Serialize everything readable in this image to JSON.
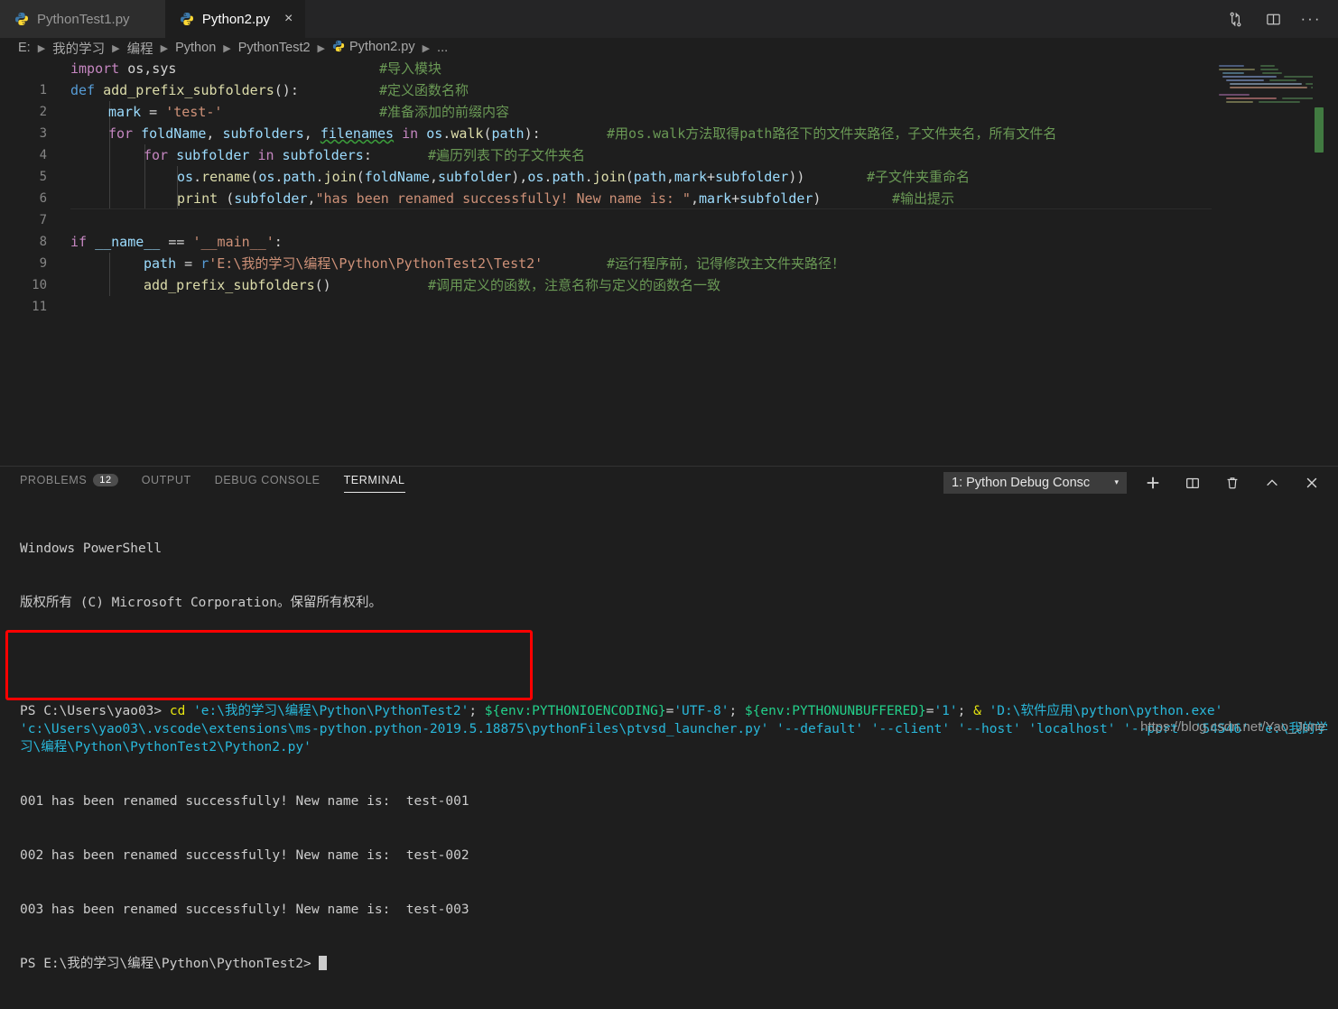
{
  "tabs": [
    {
      "label": "PythonTest1.py",
      "icon": "python-icon",
      "active": false
    },
    {
      "label": "Python2.py",
      "icon": "python-icon",
      "active": true,
      "close": "×"
    }
  ],
  "tab_actions": [
    {
      "name": "split-sync-icon",
      "label": ""
    },
    {
      "name": "split-editor-icon",
      "label": ""
    },
    {
      "name": "more-actions-icon",
      "label": "···"
    }
  ],
  "breadcrumbs": [
    "E:",
    "我的学习",
    "编程",
    "Python",
    "PythonTest2",
    "Python2.py",
    "..."
  ],
  "editor": {
    "line_numbers": [
      "1",
      "2",
      "3",
      "4",
      "5",
      "6",
      "7",
      "8",
      "9",
      "10",
      "11"
    ],
    "lines": [
      {
        "n": "1",
        "indent": 0,
        "code": "import os,sys",
        "comment": "#导入模块",
        "comment_col": 28
      },
      {
        "n": "2",
        "indent": 0,
        "code": "def add_prefix_subfolders():",
        "comment": "#定义函数名称",
        "comment_col": 36
      },
      {
        "n": "3",
        "indent": 1,
        "code": "mark = 'test-'",
        "comment": "#准备添加的前缀内容",
        "comment_col": 36
      },
      {
        "n": "4",
        "indent": 1,
        "code": "for foldName, subfolders, filenames in os.walk(path):",
        "comment": "#用os.walk方法取得path路径下的文件夹路径，子文件夹名，所有文件名",
        "comment_col": 57
      },
      {
        "n": "5",
        "indent": 2,
        "code": "for subfolder in subfolders:",
        "comment": "#遍历列表下的子文件夹名",
        "comment_col": 40
      },
      {
        "n": "6",
        "indent": 3,
        "code": "os.rename(os.path.join(foldName,subfolder),os.path.join(path,mark+subfolder))",
        "comment": "#子文件夹重命名",
        "comment_col": 82
      },
      {
        "n": "7",
        "indent": 3,
        "code": "print (subfolder,\"has been renamed successfully! New name is: \",mark+subfolder)",
        "comment": "#输出提示",
        "comment_col": 85
      },
      {
        "n": "8",
        "indent": 0,
        "code": "",
        "comment": "",
        "comment_col": 0
      },
      {
        "n": "9",
        "indent": 0,
        "code": "if __name__ == '__main__':",
        "comment": "",
        "comment_col": 0
      },
      {
        "n": "10",
        "indent": 1,
        "code": "path = r'E:\\我的学习\\编程\\Python\\PythonTest2\\Test2'",
        "comment": "#运行程序前，记得修改主文件夹路径！",
        "comment_col": 46
      },
      {
        "n": "11",
        "indent": 1,
        "code": "add_prefix_subfolders()",
        "comment": "#调用定义的函数，注意名称与定义的函数名一致",
        "comment_col": 33
      }
    ]
  },
  "panel": {
    "tabs": [
      {
        "label": "PROBLEMS",
        "badge": "12",
        "active": false
      },
      {
        "label": "OUTPUT",
        "badge": "",
        "active": false
      },
      {
        "label": "DEBUG CONSOLE",
        "badge": "",
        "active": false
      },
      {
        "label": "TERMINAL",
        "badge": "",
        "active": true
      }
    ],
    "terminal_selector": "1: Python Debug Consc",
    "terminal_selector_caret": "▾",
    "actions": [
      {
        "name": "new-terminal-icon",
        "glyph": "+"
      },
      {
        "name": "split-terminal-icon",
        "glyph": ""
      },
      {
        "name": "kill-terminal-icon",
        "glyph": ""
      },
      {
        "name": "maximize-panel-icon",
        "glyph": "∧"
      },
      {
        "name": "close-panel-icon",
        "glyph": "✕"
      }
    ]
  },
  "terminal": {
    "header_line1": "Windows PowerShell",
    "header_line2": "版权所有 (C) Microsoft Corporation。保留所有权利。",
    "prompt1": "PS C:\\Users\\yao03> ",
    "cmd_cd": "cd ",
    "cmd_path": "'e:\\我的学习\\编程\\Python\\PythonTest2'",
    "cmd_rest1": "; ",
    "cmd_env1": "${env:PYTHONIOENCODING}",
    "cmd_eq1": "=",
    "cmd_val1": "'UTF-8'",
    "cmd_semi1": "; ",
    "cmd_env2": "${env:PYTHONUNBUFFERED}",
    "cmd_eq2": "=",
    "cmd_val2": "'1'",
    "cmd_semi2": "; ",
    "cmd_amp": "& ",
    "cmd_exe": "'D:\\软件应用\\python\\python.exe'",
    "cmd_launcher": " 'c:\\Users\\yao03\\.vscode\\extensions\\ms-python.python-2019.5.18875\\pythonFiles\\ptvsd_launcher.py'",
    "cmd_args": " '--default' '--client' '--host' 'localhost' '--port' '54546' 'e:\\我的学习\\编程\\Python\\PythonTest2\\Python2.py'",
    "output_lines": [
      "001 has been renamed successfully! New name is:  test-001",
      "002 has been renamed successfully! New name is:  test-002",
      "003 has been renamed successfully! New name is:  test-003"
    ],
    "prompt2": "PS E:\\我的学习\\编程\\Python\\PythonTest2> "
  },
  "watermark": "https://blog.csdn.net/Yao_June",
  "colors": {
    "editor_bg": "#1e1e1e",
    "tabbar_bg": "#252526",
    "highlight_box": "#ff0000",
    "accent_green": "#23d18b",
    "accent_cyan": "#29b8db",
    "accent_yellow": "#e5e510"
  }
}
